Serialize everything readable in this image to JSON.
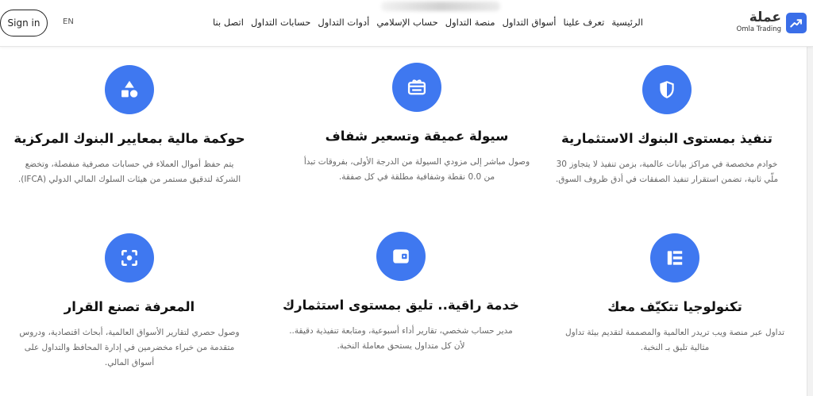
{
  "header": {
    "signin_label": "Sign in",
    "lang_label": "EN",
    "nav": [
      "الرئيسية",
      "تعرف علينا",
      "أسواق التداول",
      "منصة التداول",
      "حساب الإسلامي",
      "أدوات التداول",
      "حسابات التداول",
      "اتصل بنا"
    ],
    "logo": {
      "arabic": "عملة",
      "english": "Omla Trading",
      "icon": "trending-up-icon"
    }
  },
  "cards": [
    {
      "icon": "shield-icon",
      "title": "تنفيذ بمستوى البنوك الاستثمارية",
      "desc": "خوادم مخصصة في مراكز بيانات عالمية، بزمن تنفيذ لا يتجاوز 30 ملّي ثانية، تضمن استقرار تنفيذ الصفقات في أدق ظروف السوق."
    },
    {
      "icon": "gift-card-icon",
      "title": "سيولة عميقة وتسعير شفاف",
      "desc": "وصول مباشر إلى مزودي السيولة من الدرجة الأولى، بفروقات تبدأ من 0.0 نقطة وشفافية مطلقة في كل صفقة."
    },
    {
      "icon": "shapes-icon",
      "title": "حوكمة مالية بمعايير البنوك المركزية",
      "desc": "يتم حفظ أموال العملاء في حسابات مصرفية منفصلة، وتخضع الشركة لتدقيق مستمر من هيئات السلوك المالي الدولي (IFCA)."
    },
    {
      "icon": "columns-icon",
      "title": "تكنولوجيا تتكيّف معك",
      "desc": "تداول عبر منصة ويب تريدر العالمية والمصممة لتقديم بيئة تداول مثالية تليق بـ النخبة."
    },
    {
      "icon": "wallet-icon",
      "title": "خدمة راقية.. تليق بمستوى استثمارك",
      "desc": "مدير حساب شخصي، تقارير أداء أسبوعية، ومتابعة تنفيذية دقيقة.. لأن كل متداول يستحق معاملة النخبة."
    },
    {
      "icon": "focus-icon",
      "title": "المعرفة تصنع القرار",
      "desc": "وصول حصري لتقارير الأسواق العالمية، أبحاث اقتصادية، ودروس متقدمة من خبراء مخضرمين في إدارة المحافظ والتداول على أسواق المالي."
    }
  ],
  "colors": {
    "accent": "#3f78f0",
    "logo": "#3a6ee8"
  }
}
